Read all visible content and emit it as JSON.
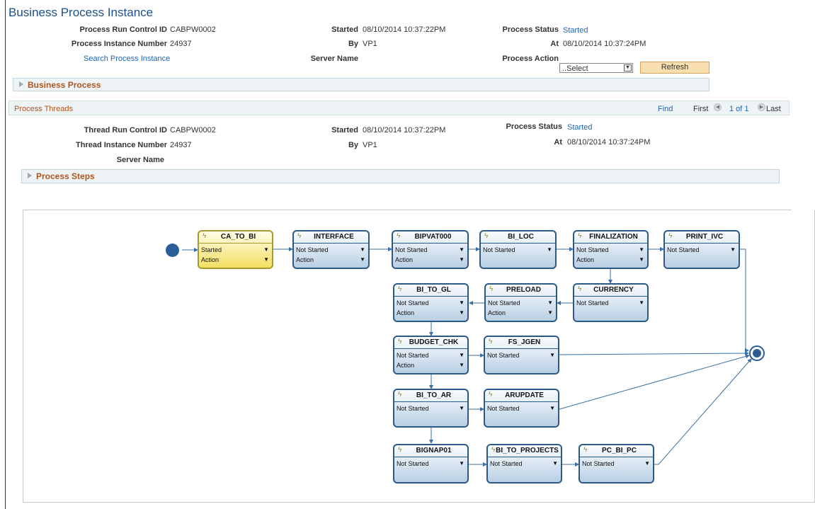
{
  "page": {
    "title": "Business Process Instance"
  },
  "header": {
    "run_control_label": "Process Run Control ID",
    "run_control_value": "CABPW0002",
    "instance_label": "Process Instance Number",
    "instance_value": "24937",
    "search_link": "Search Process Instance",
    "started_label": "Started",
    "started_value": "08/10/2014 10:37:22PM",
    "by_label": "By",
    "by_value": "VP1",
    "server_label": "Server Name",
    "status_label": "Process Status",
    "status_value": "Started",
    "at_label": "At",
    "at_value": "08/10/2014 10:37:24PM",
    "action_label": "Process Action",
    "action_selected": "..Select",
    "refresh_label": "Refresh"
  },
  "business_process_bar": "Business Process",
  "threads": {
    "title": "Process Threads",
    "find": "Find",
    "first": "First",
    "page_info": "1 of 1",
    "last": "Last",
    "run_control_label": "Thread Run Control ID",
    "run_control_value": "CABPW0002",
    "instance_label": "Thread Instance Number",
    "instance_value": "24937",
    "server_label": "Server Name",
    "started_label": "Started",
    "started_value": "08/10/2014 10:37:22PM",
    "by_label": "By",
    "by_value": "VP1",
    "status_label": "Process Status",
    "status_value": "Started",
    "at_label": "At",
    "at_value": "08/10/2014 10:37:24PM"
  },
  "process_steps_bar": "Process Steps",
  "nodes": [
    {
      "name": "CA_TO_BI",
      "status": "Started",
      "action": "Action",
      "active": true
    },
    {
      "name": "INTERFACE",
      "status": "Not Started",
      "action": "Action"
    },
    {
      "name": "BIPVAT000",
      "status": "Not Started",
      "action": "Action"
    },
    {
      "name": "BI_LOC",
      "status": "Not Started",
      "action": ""
    },
    {
      "name": "FINALIZATION",
      "status": "Not Started",
      "action": "Action"
    },
    {
      "name": "PRINT_IVC",
      "status": "Not Started",
      "action": ""
    },
    {
      "name": "BI_TO_GL",
      "status": "Not Started",
      "action": "Action"
    },
    {
      "name": "PRELOAD",
      "status": "Not Started",
      "action": "Action"
    },
    {
      "name": "CURRENCY",
      "status": "Not Started",
      "action": ""
    },
    {
      "name": "BUDGET_CHK",
      "status": "Not Started",
      "action": "Action"
    },
    {
      "name": "FS_JGEN",
      "status": "Not Started",
      "action": ""
    },
    {
      "name": "BI_TO_AR",
      "status": "Not Started",
      "action": ""
    },
    {
      "name": "ARUPDATE",
      "status": "Not Started",
      "action": ""
    },
    {
      "name": "BIGNAP01",
      "status": "Not Started",
      "action": ""
    },
    {
      "name": "BI_TO_PROJECTS",
      "status": "Not Started",
      "action": ""
    },
    {
      "name": "PC_BI_PC",
      "status": "Not Started",
      "action": ""
    }
  ]
}
